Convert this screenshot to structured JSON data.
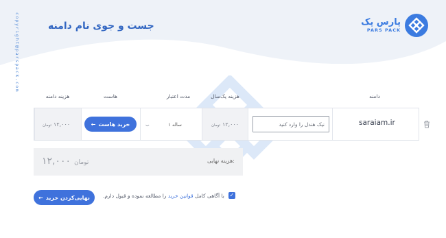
{
  "brand": {
    "name_fa": "پارس پک",
    "name_en": "PARS PACK",
    "email": "copyright@parspack.com"
  },
  "page": {
    "title": "جست و جوی نام دامنه"
  },
  "table": {
    "headers": {
      "domain": "دامنه",
      "yearly_cost": "هزینه یک‌سال",
      "validity": "مدت اعتبار",
      "host": "هاست",
      "domain_cost": "هزینه دامنه"
    },
    "row": {
      "domain": "saraiam.ir",
      "handle_placeholder": "نیک هندل را وارد کنید",
      "yearly_price": "۱۲,۰۰۰",
      "yearly_unit": "تومان",
      "validity_value": "۱ ساله",
      "buy_host_label": "خرید هاست",
      "domain_price": "۱۲,۰۰۰",
      "domain_unit": "تومان"
    }
  },
  "total": {
    "label": "هزینه نهایی:",
    "price": "۱۲,۰۰۰",
    "unit": "تومان"
  },
  "terms": {
    "prefix": "با آگاهی کامل",
    "link": "قوانین خرید",
    "suffix": "را مطالعه نموده و قبول دارم.",
    "checked": true
  },
  "finalize_button": "نهایی‌کردن خرید",
  "colors": {
    "accent": "#3f72dc",
    "title": "#3367c2"
  }
}
